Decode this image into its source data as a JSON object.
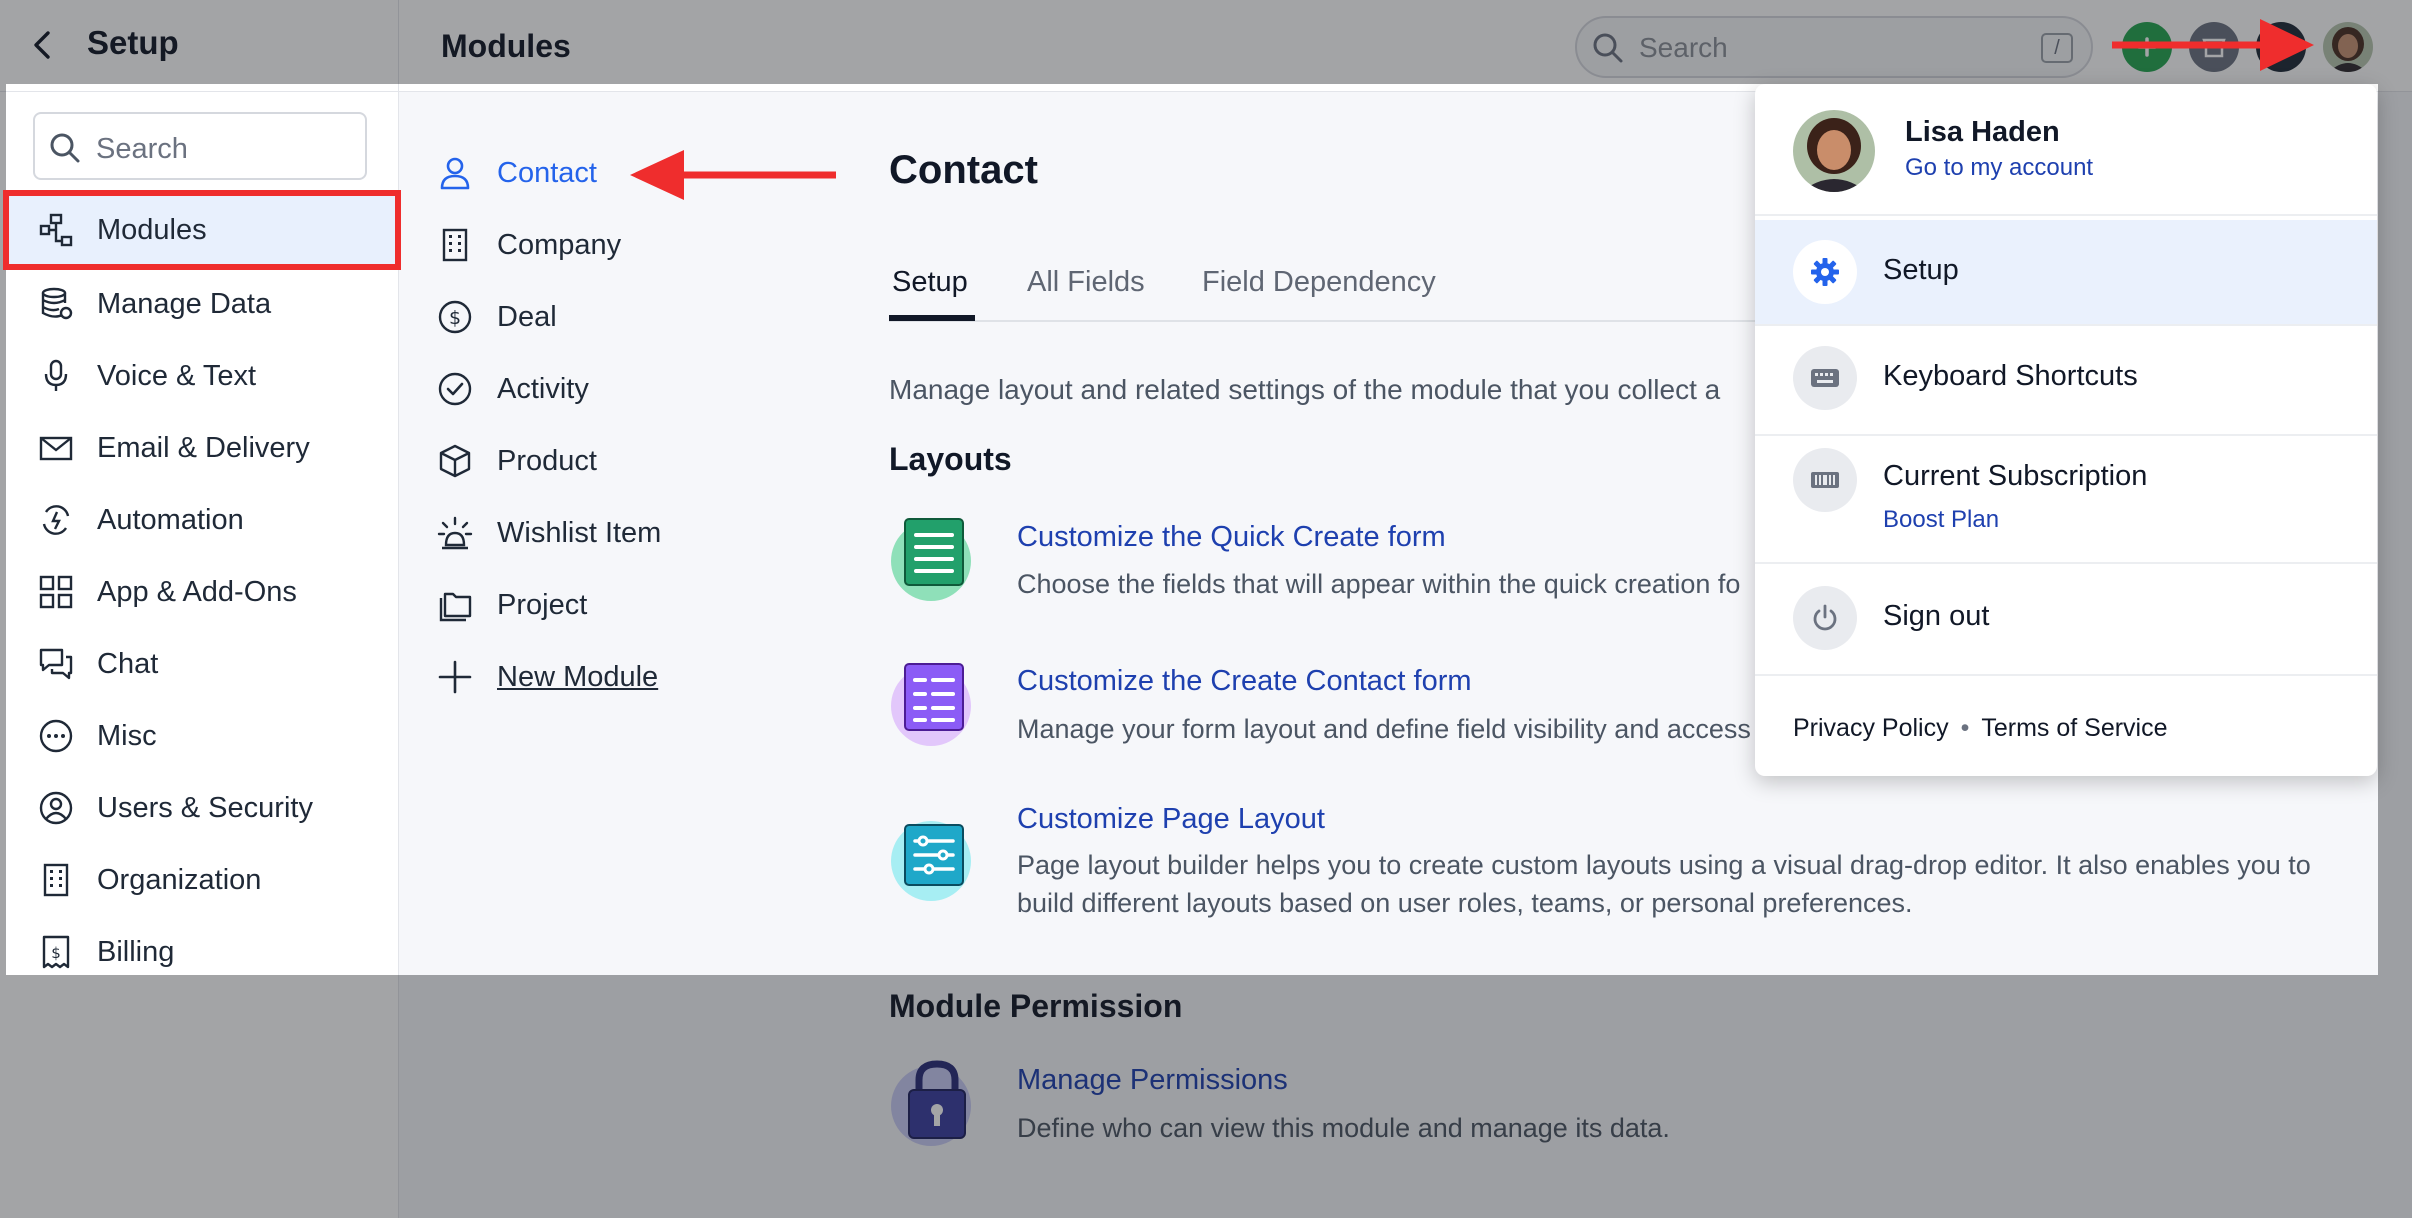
{
  "header": {
    "back_icon": "chevron-left-icon",
    "setup_title": "Setup",
    "page_title": "Modules",
    "search_placeholder": "Search",
    "search_shortcut": "/"
  },
  "sidebar": {
    "search_placeholder": "Search",
    "active_item": "Modules",
    "items": [
      {
        "label": "Modules",
        "icon": "modules-icon"
      },
      {
        "label": "Manage Data",
        "icon": "database-icon"
      },
      {
        "label": "Voice & Text",
        "icon": "microphone-icon"
      },
      {
        "label": "Email & Delivery",
        "icon": "mail-icon"
      },
      {
        "label": "Automation",
        "icon": "automation-icon"
      },
      {
        "label": "App & Add-Ons",
        "icon": "grid-icon"
      },
      {
        "label": "Chat",
        "icon": "chat-icon"
      },
      {
        "label": "Misc",
        "icon": "more-icon"
      },
      {
        "label": "Users & Security",
        "icon": "user-circle-icon"
      },
      {
        "label": "Organization",
        "icon": "building-icon"
      },
      {
        "label": "Billing",
        "icon": "billing-icon"
      }
    ]
  },
  "modules": {
    "active": "Contact",
    "items": [
      {
        "label": "Contact",
        "icon": "person-icon"
      },
      {
        "label": "Company",
        "icon": "building-icon"
      },
      {
        "label": "Deal",
        "icon": "dollar-icon"
      },
      {
        "label": "Activity",
        "icon": "check-circle-icon"
      },
      {
        "label": "Product",
        "icon": "box-icon"
      },
      {
        "label": "Wishlist Item",
        "icon": "lamp-icon"
      },
      {
        "label": "Project",
        "icon": "folders-icon"
      }
    ],
    "new_module_label": "New Module"
  },
  "content": {
    "title": "Contact",
    "tabs": [
      "Setup",
      "All Fields",
      "Field Dependency"
    ],
    "active_tab": "Setup",
    "description": "Manage layout and related settings of the module that you collect a",
    "layouts_heading": "Layouts",
    "cards": [
      {
        "title": "Customize the Quick Create form",
        "desc": "Choose the fields that will appear within the quick creation fo",
        "icon": "list-form-icon",
        "color": "#22a06b"
      },
      {
        "title": "Customize the Create Contact form",
        "desc": "Manage your form layout and define field visibility and access",
        "icon": "grid-form-icon",
        "color": "#8b5cf6"
      },
      {
        "title": "Customize Page Layout",
        "desc": "Page layout builder helps you to create custom layouts using a visual drag-drop editor. It also enables you to build different layouts based on user roles, teams, or personal preferences.",
        "icon": "sliders-icon",
        "color": "#1fa8c9"
      }
    ],
    "permission_heading": "Module Permission",
    "permission_card": {
      "title": "Manage Permissions",
      "desc": "Define who can view this module and manage its data.",
      "icon": "lock-icon",
      "color": "#3b3fa0"
    }
  },
  "profile_menu": {
    "name": "Lisa Haden",
    "account_link": "Go to my account",
    "items": [
      {
        "label": "Setup",
        "icon": "gear-icon"
      },
      {
        "label": "Keyboard Shortcuts",
        "icon": "keyboard-icon"
      },
      {
        "label": "Current Subscription",
        "sub": "Boost Plan",
        "icon": "subscription-icon"
      },
      {
        "label": "Sign out",
        "icon": "power-icon"
      }
    ],
    "footer": {
      "privacy": "Privacy Policy",
      "terms": "Terms of Service"
    }
  },
  "colors": {
    "accent": "#2463eb",
    "link": "#1e40af",
    "annotation": "#ef2d2d",
    "add_button": "#26a551"
  }
}
